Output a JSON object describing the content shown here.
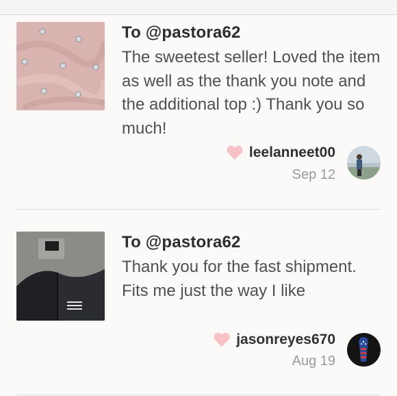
{
  "reviews": [
    {
      "to": "To @pastora62",
      "message": "The sweetest seller! Loved the item as well as the thank you note and the additional top :) Thank you so much!",
      "username": "leelanneet00",
      "date": "Sep 12",
      "thumbnail": "pink-embellished-top",
      "avatar": "beach-person-avatar"
    },
    {
      "to": "To @pastora62",
      "message": "Thank you for the fast shipment. Fits me just the way I like",
      "username": "jasonreyes670",
      "date": "Aug 19",
      "thumbnail": "the-north-face-jacket",
      "avatar": "flag-avatar"
    }
  ],
  "colors": {
    "heart": "#f7c2c6",
    "accent_text": "#2d2d2d",
    "muted": "#9a9a9a"
  }
}
